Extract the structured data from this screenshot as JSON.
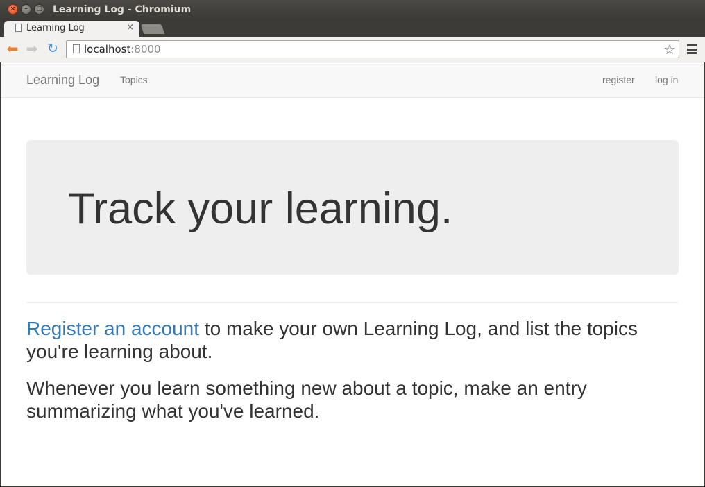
{
  "window": {
    "title": "Learning Log - Chromium"
  },
  "tab": {
    "label": "Learning Log",
    "close_glyph": "×"
  },
  "toolbar": {
    "url_host": "localhost",
    "url_port": ":8000"
  },
  "navbar": {
    "brand": "Learning Log",
    "topics": "Topics",
    "register": "register",
    "login": "log in"
  },
  "jumbotron": {
    "title": "Track your learning."
  },
  "content": {
    "register_link": "Register an account",
    "paragraph1_rest": " to make your own Learning Log, and list the topics you're learning about.",
    "paragraph2": "Whenever you learn something new about a topic, make an entry summarizing what you've learned."
  },
  "colors": {
    "link": "#337ab7",
    "navbar_bg": "#f8f8f8",
    "jumbotron_bg": "#eeeeee"
  }
}
